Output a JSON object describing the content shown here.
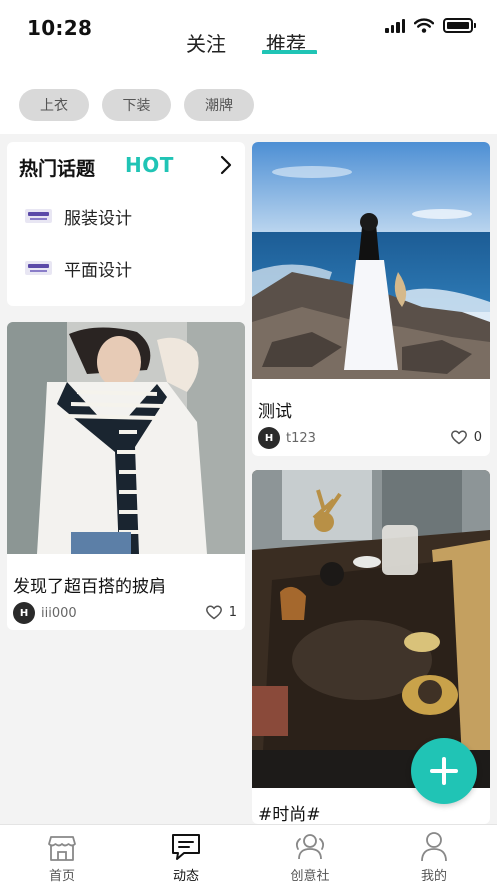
{
  "status_bar": {
    "time": "10:28",
    "battery_level": 1.0
  },
  "top_tabs": [
    {
      "label": "关注",
      "active": false
    },
    {
      "label": "推荐",
      "active": true
    }
  ],
  "accent_color": "#20c4b5",
  "categories": [
    "上衣",
    "下装",
    "潮牌"
  ],
  "hot_topics": {
    "title": "热门话题",
    "badge": "HOT",
    "items": [
      {
        "label": "服装设计",
        "icon": "topic-logo-icon"
      },
      {
        "label": "平面设计",
        "icon": "topic-logo-icon"
      }
    ]
  },
  "posts": [
    {
      "title": "测试",
      "author": "t123",
      "avatar_text": "H",
      "likes": "0"
    },
    {
      "title": "发现了超百搭的披肩",
      "author": "iii000",
      "avatar_text": "H",
      "likes": "1"
    },
    {
      "title": "#时尚#"
    }
  ],
  "bottom_nav": [
    {
      "label": "首页",
      "icon": "shop-icon",
      "active": false
    },
    {
      "label": "动态",
      "icon": "chat-icon",
      "active": true
    },
    {
      "label": "创意社",
      "icon": "community-icon",
      "active": false
    },
    {
      "label": "我的",
      "icon": "person-icon",
      "active": false
    }
  ]
}
